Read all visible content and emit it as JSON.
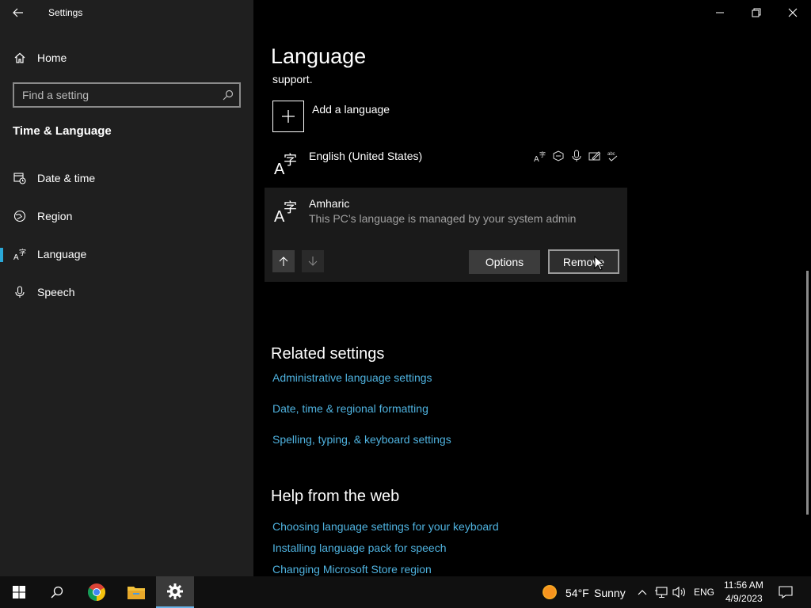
{
  "app": {
    "title": "Settings"
  },
  "sidebar": {
    "home_label": "Home",
    "search_placeholder": "Find a setting",
    "section_title": "Time & Language",
    "items": [
      {
        "label": "Date & time",
        "icon": "calendar-clock-icon"
      },
      {
        "label": "Region",
        "icon": "globe-icon"
      },
      {
        "label": "Language",
        "icon": "language-icon",
        "selected": true
      },
      {
        "label": "Speech",
        "icon": "microphone-icon"
      }
    ]
  },
  "main": {
    "page_title": "Language",
    "support_text": "support.",
    "add_language_label": "Add a language",
    "languages": [
      {
        "name": "English (United States)",
        "subtitle": ""
      },
      {
        "name": "Amharic",
        "subtitle": "This PC’s language is managed by your system admin"
      }
    ],
    "options_label": "Options",
    "remove_label": "Remove",
    "related_title": "Related settings",
    "related_links": [
      "Administrative language settings",
      "Date, time & regional formatting",
      "Spelling, typing, & keyboard settings"
    ],
    "help_title": "Help from the web",
    "help_links": [
      "Choosing language settings for your keyboard",
      "Installing language pack for speech",
      "Changing Microsoft Store region"
    ]
  },
  "taskbar": {
    "weather_temp": "54°F",
    "weather_desc": "Sunny",
    "input_lang": "ENG",
    "time": "11:56 AM",
    "date": "4/9/2023"
  },
  "colors": {
    "accent": "#2aa8d8",
    "link": "#4fb3e0",
    "sidebar_bg": "#1f1f1f",
    "main_bg": "#000000"
  }
}
